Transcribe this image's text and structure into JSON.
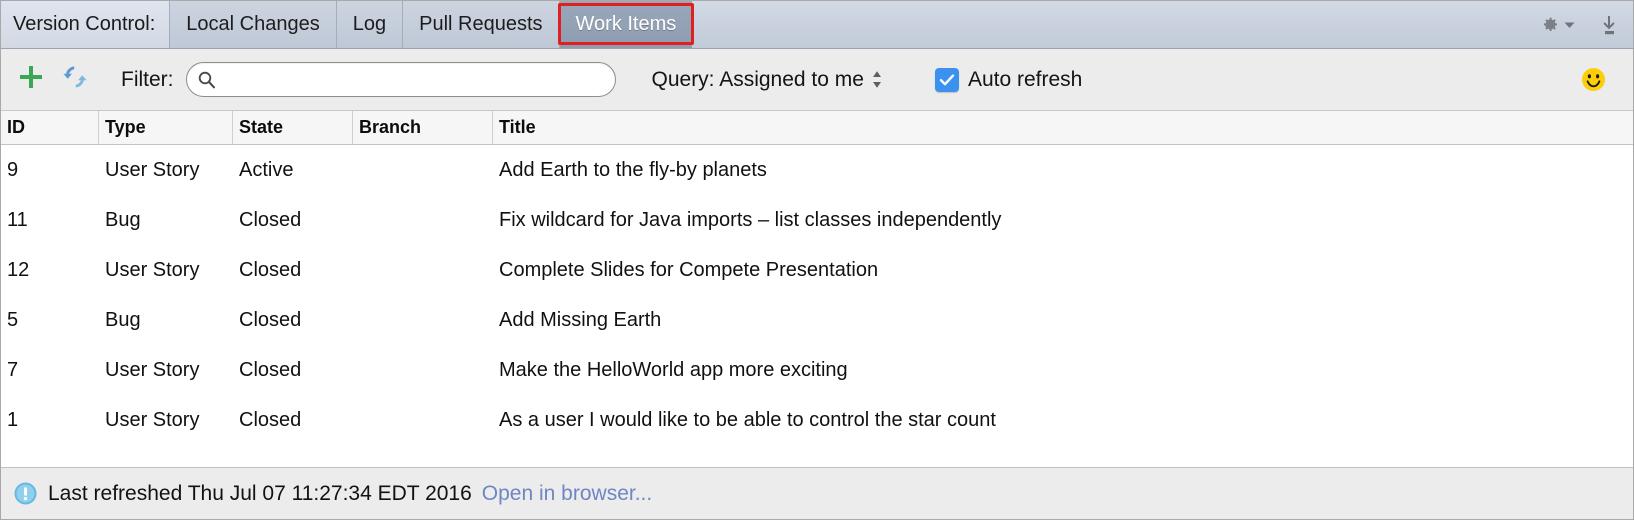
{
  "tabbar": {
    "title": "Version Control:",
    "tabs": [
      {
        "label": "Local Changes",
        "selected": false
      },
      {
        "label": "Log",
        "selected": false
      },
      {
        "label": "Pull Requests",
        "selected": false
      },
      {
        "label": "Work Items",
        "selected": true
      }
    ],
    "icons": {
      "settings": "gear-icon",
      "settings_dropdown": "chevron-down-icon",
      "hide": "hide-panel-icon"
    },
    "highlight_color": "#e02020",
    "selected_tab_bg": "#9aa7ba"
  },
  "toolbar": {
    "add_icon": "plus-icon",
    "refresh_icon": "refresh-icon",
    "filter_label": "Filter:",
    "search": {
      "value": "",
      "placeholder": "",
      "icon": "search-icon"
    },
    "query": {
      "label": "Query: Assigned to me",
      "stepper_icon": "up-down-stepper-icon"
    },
    "auto_refresh": {
      "label": "Auto refresh",
      "checked": true,
      "accent": "#3b91f0"
    },
    "status_icon": "smiley-face-icon"
  },
  "table": {
    "columns": [
      "ID",
      "Type",
      "State",
      "Branch",
      "Title"
    ],
    "rows": [
      {
        "id": "9",
        "type": "User Story",
        "state": "Active",
        "branch": "",
        "title": "Add Earth to the fly-by planets"
      },
      {
        "id": "11",
        "type": "Bug",
        "state": "Closed",
        "branch": "",
        "title": "Fix wildcard for Java imports – list classes independently"
      },
      {
        "id": "12",
        "type": "User Story",
        "state": "Closed",
        "branch": "",
        "title": "Complete Slides for Compete Presentation"
      },
      {
        "id": "5",
        "type": "Bug",
        "state": "Closed",
        "branch": "",
        "title": "Add Missing Earth"
      },
      {
        "id": "7",
        "type": "User Story",
        "state": "Closed",
        "branch": "",
        "title": "Make the HelloWorld app more exciting"
      },
      {
        "id": "1",
        "type": "User Story",
        "state": "Closed",
        "branch": "",
        "title": "As a user I would like to be able to control the star count"
      }
    ]
  },
  "statusbar": {
    "icon": "info-icon",
    "text": "Last refreshed Thu Jul 07 11:27:34 EDT 2016",
    "link": "Open in browser...",
    "link_color": "#6f86c4"
  }
}
